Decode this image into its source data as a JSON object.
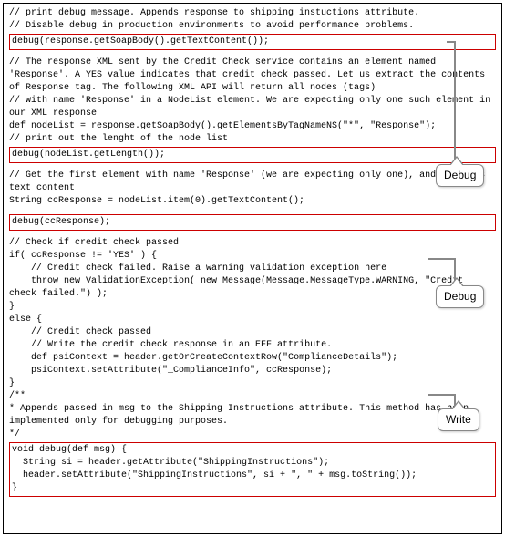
{
  "code": {
    "c1": "// print debug message. Appends response to shipping instuctions attribute.",
    "c2": "// Disable debug in production environments to avoid performance problems.",
    "r1": "debug(response.getSoapBody().getTextContent());",
    "c3": "// The response XML sent by the Credit Check service contains an element named 'Response'. A YES value indicates that credit check passed. Let us extract the contents of Response tag. The following XML API will return all nodes (tags)",
    "c4": "// with name 'Response' in a NodeList element. We are expecting only one such element in our XML response",
    "c5": "def nodeList = response.getSoapBody().getElementsByTagNameNS(\"*\", \"Response\");",
    "c6": "// print out the lenght of the node list",
    "r2": "debug(nodeList.getLength());",
    "c7": "// Get the first element with name 'Response' (we are expecting only one), and gets its text content",
    "c8": "String ccResponse = nodeList.item(0).getTextContent();",
    "r3": "debug(ccResponse);",
    "c9": "// Check if credit check passed",
    "c10": "if( ccResponse != 'YES' ) {",
    "c11": "    // Credit check failed. Raise a warning validation exception here",
    "c12": "    throw new ValidationException( new Message(Message.MessageType.WARNING, \"Credit check failed.\") );",
    "c13": "}",
    "c14": "else {",
    "c15": "    // Credit check passed",
    "c16": "    // Write the credit check response in an EFF attribute.",
    "c17": "    def psiContext = header.getOrCreateContextRow(\"ComplianceDetails\");",
    "c18": "    psiContext.setAttribute(\"_ComplianceInfo\", ccResponse);",
    "c19": "}",
    "c20": "/**",
    "c21": "* Appends passed in msg to the Shipping Instructions attribute. This method has been implemented only for debugging purposes.",
    "c22": "*/",
    "r4a": "void debug(def msg) {",
    "r4b": "  String si = header.getAttribute(\"ShippingInstructions\");",
    "r4c": "  header.setAttribute(\"ShippingInstructions\", si + \", \" + msg.toString());",
    "r4d": "}"
  },
  "callouts": {
    "debug1": "Debug",
    "debug2": "Debug",
    "write": "Write"
  }
}
